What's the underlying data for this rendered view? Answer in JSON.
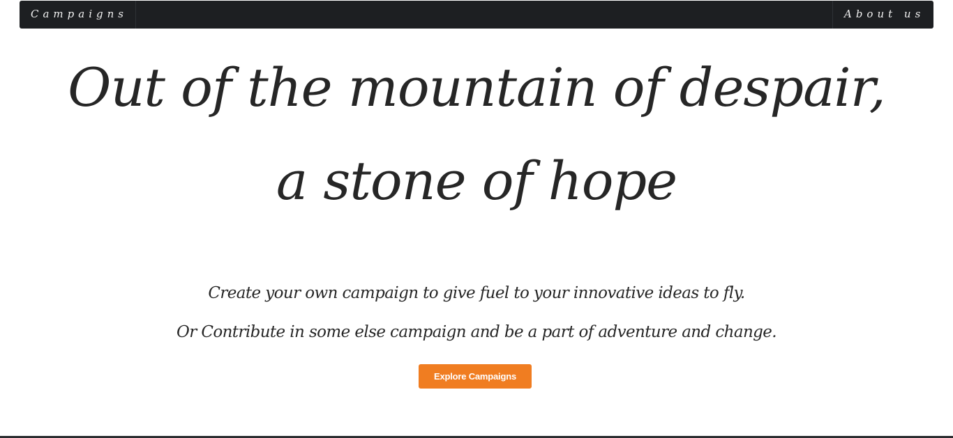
{
  "nav": {
    "left_label": "Campaigns",
    "right_label": "About us"
  },
  "hero": {
    "headline_line1": "Out of the mountain of despair,",
    "headline_line2": "a stone of hope",
    "subline1": "Create your own campaign to give fuel to your innovative ideas to fly.",
    "subline2": "Or Contribute in some else campaign and be a part of adventure and change.",
    "cta_label": "Explore Campaigns"
  },
  "colors": {
    "navbar_bg": "#1d1f22",
    "cta_bg": "#f07d21",
    "text": "#262626"
  }
}
